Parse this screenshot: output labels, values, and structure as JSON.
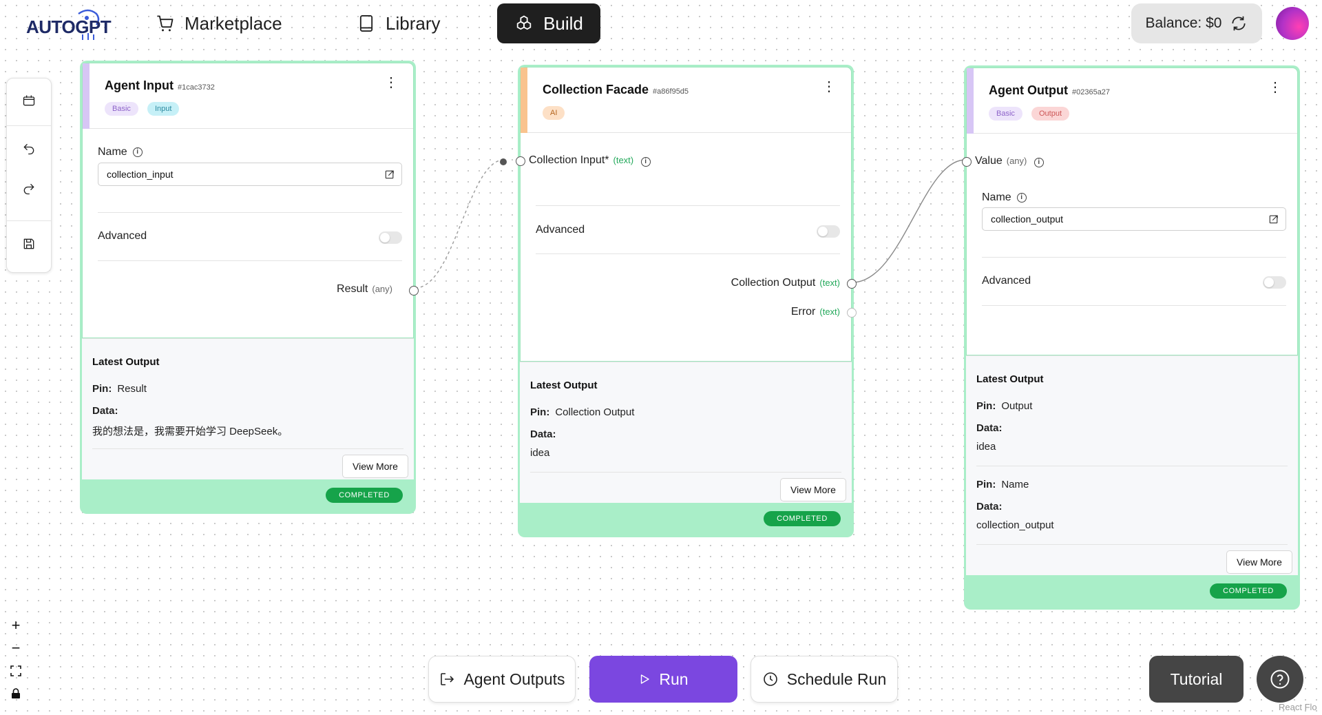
{
  "nav": {
    "logo_text": "AUTOGPT",
    "marketplace": "Marketplace",
    "library": "Library",
    "build": "Build",
    "balance": "Balance: $0"
  },
  "bottom": {
    "agent_outputs": "Agent Outputs",
    "run": "Run",
    "schedule_run": "Schedule Run",
    "tutorial": "Tutorial",
    "attribution": "React Flo"
  },
  "nodes": {
    "agent_input": {
      "title": "Agent Input",
      "id": "#1cac3732",
      "tags": [
        "Basic",
        "Input"
      ],
      "name_label": "Name",
      "name_value": "collection_input",
      "advanced_label": "Advanced",
      "output_pin": "Result",
      "output_pin_type": "(any)",
      "latest_output_title": "Latest Output",
      "pin_label": "Pin:",
      "pin_value": "Result",
      "data_label": "Data:",
      "data_value": "我的想法是，我需要开始学习 DeepSeek。",
      "view_more": "View More",
      "status": "COMPLETED"
    },
    "collection_facade": {
      "title": "Collection Facade",
      "id": "#a86f95d5",
      "tags": [
        "AI"
      ],
      "input_pin": "Collection Input*",
      "input_pin_type": "(text)",
      "advanced_label": "Advanced",
      "output_pin_1": "Collection Output",
      "output_pin_1_type": "(text)",
      "output_pin_2": "Error",
      "output_pin_2_type": "(text)",
      "latest_output_title": "Latest Output",
      "pin_label": "Pin:",
      "pin_value": "Collection Output",
      "data_label": "Data:",
      "data_value": "idea",
      "view_more": "View More",
      "status": "COMPLETED"
    },
    "agent_output": {
      "title": "Agent Output",
      "id": "#02365a27",
      "tags": [
        "Basic",
        "Output"
      ],
      "input_pin": "Value",
      "input_pin_type": "(any)",
      "name_label": "Name",
      "name_value": "collection_output",
      "advanced_label": "Advanced",
      "latest_output_title": "Latest Output",
      "pin_label": "Pin:",
      "pin_value": "Output",
      "data_label": "Data:",
      "data_value": "idea",
      "pin2_label": "Pin:",
      "pin2_value": "Name",
      "data2_label": "Data:",
      "data2_value": "collection_output",
      "view_more": "View More",
      "status": "COMPLETED"
    }
  },
  "colors": {
    "node_border": "#a9eec8",
    "accent_basic": "#d7c6f5",
    "accent_ai": "#f9c38e",
    "tag_basic_bg": "#ede4fb",
    "tag_basic_fg": "#8d63c9",
    "tag_input_bg": "#c6f0f7",
    "tag_input_fg": "#2b8aa0",
    "tag_output_bg": "#fbd6d6",
    "tag_output_fg": "#c55",
    "tag_ai_bg": "#fde0c6",
    "tag_ai_fg": "#b3651e",
    "pin_type": "#22a85a",
    "run_button": "#7b47e0",
    "status": "#16a34a"
  }
}
